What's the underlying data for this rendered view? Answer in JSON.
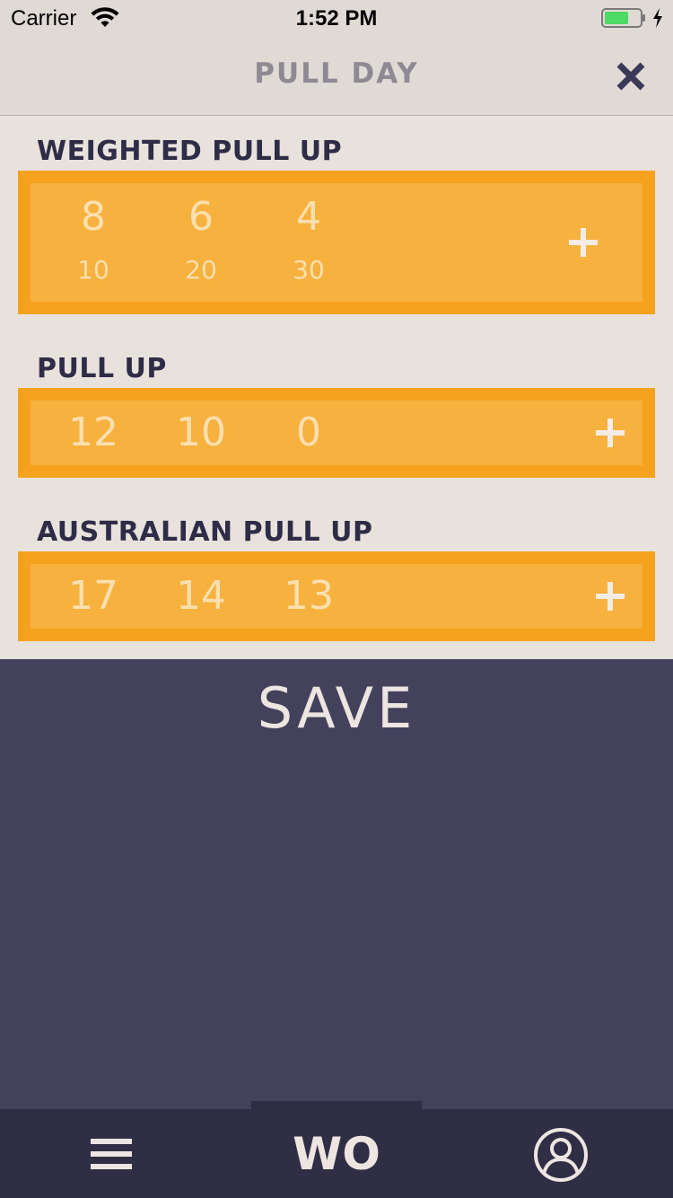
{
  "status_bar": {
    "carrier": "Carrier",
    "time": "1:52 PM"
  },
  "header": {
    "title": "PULL DAY",
    "close_icon": "close-icon"
  },
  "exercises": [
    {
      "name": "WEIGHTED PULL UP",
      "sets": [
        {
          "reps": "8",
          "weight": "10"
        },
        {
          "reps": "6",
          "weight": "20"
        },
        {
          "reps": "4",
          "weight": "30"
        }
      ]
    },
    {
      "name": "PULL UP",
      "sets": [
        {
          "reps": "12"
        },
        {
          "reps": "10"
        },
        {
          "reps": "0"
        }
      ]
    },
    {
      "name": "AUSTRALIAN PULL UP",
      "sets": [
        {
          "reps": "17"
        },
        {
          "reps": "14"
        },
        {
          "reps": "13"
        }
      ]
    }
  ],
  "save_label": "SAVE",
  "tabs": {
    "menu_icon": "menu-icon",
    "workout_label": "WO",
    "profile_icon": "profile-icon"
  },
  "colors": {
    "card_border": "#f6a21e",
    "card_fill": "#f6b13e",
    "card_text": "#fae0b0",
    "header_bg": "#e0dad5",
    "content_bg": "#e8e2dd",
    "dark_bg": "#43415c",
    "tab_bar_bg": "#302e45",
    "title_text": "#2e2c46"
  }
}
